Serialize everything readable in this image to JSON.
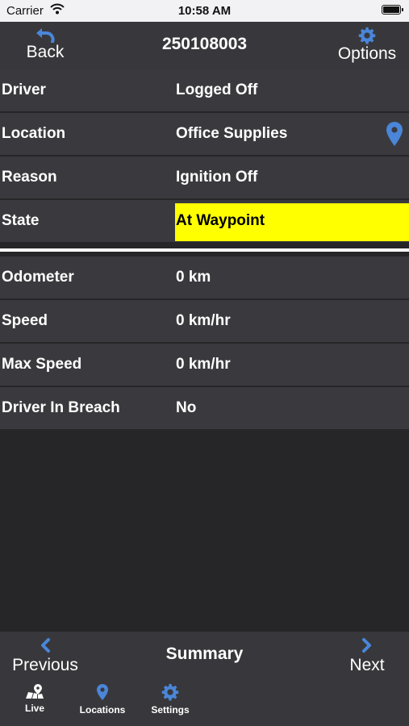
{
  "status_bar": {
    "carrier": "Carrier",
    "time": "10:58 AM",
    "battery_level": 1.0
  },
  "nav": {
    "back_label": "Back",
    "back_icon": "undo-arrow-icon",
    "title": "250108003",
    "options_label": "Options",
    "options_icon": "gear-icon"
  },
  "details": {
    "driver": {
      "key": "Driver",
      "value": "Logged Off"
    },
    "location": {
      "key": "Location",
      "value": "Office Supplies",
      "icon": "map-pin-icon"
    },
    "reason": {
      "key": "Reason",
      "value": "Ignition Off"
    },
    "state": {
      "key": "State",
      "value": "At Waypoint",
      "highlight_color": "#ffff00"
    }
  },
  "metrics": {
    "odometer": {
      "key": "Odometer",
      "value": "0 km"
    },
    "speed": {
      "key": "Speed",
      "value": "0 km/hr"
    },
    "max_speed": {
      "key": "Max Speed",
      "value": "0 km/hr"
    },
    "driver_in_breach": {
      "key": "Driver In Breach",
      "value": "No"
    }
  },
  "footer": {
    "previous_label": "Previous",
    "title": "Summary",
    "next_label": "Next"
  },
  "tabs": [
    {
      "label": "Live",
      "icon": "live-map-icon"
    },
    {
      "label": "Locations",
      "icon": "map-pin-icon"
    },
    {
      "label": "Settings",
      "icon": "gear-icon"
    }
  ],
  "colors": {
    "accent": "#4a86d9",
    "background": "#262628",
    "row_background": "#3a3a3e",
    "bar_background": "#38383c"
  }
}
